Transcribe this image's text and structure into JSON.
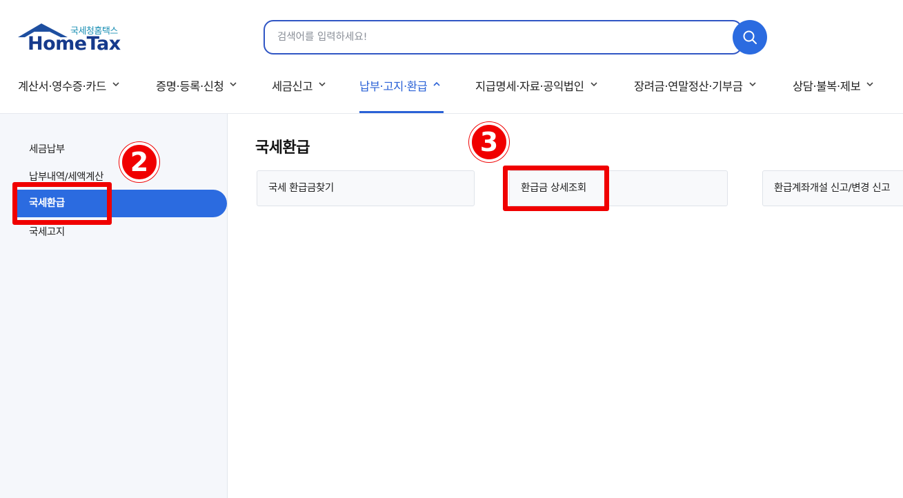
{
  "logo": {
    "sub_text": "국세청홈택스",
    "main_text": "HomeTax"
  },
  "search": {
    "placeholder": "검색어를 입력하세요!"
  },
  "nav": {
    "items": [
      {
        "label": "계산서·영수증·카드"
      },
      {
        "label": "증명·등록·신청"
      },
      {
        "label": "세금신고"
      },
      {
        "label": "납부·고지·환급"
      },
      {
        "label": "지급명세·자료·공익법인"
      },
      {
        "label": "장려금·연말정산·기부금"
      },
      {
        "label": "상담·불복·제보"
      }
    ],
    "active_index": 3
  },
  "sidebar": {
    "items": [
      {
        "label": "세금납부"
      },
      {
        "label": "납부내역/세액계산"
      },
      {
        "label": "국세환급"
      },
      {
        "label": "국세고지"
      }
    ],
    "active_index": 2
  },
  "content": {
    "title": "국세환급",
    "cards": [
      {
        "label": "국세 환급금찾기"
      },
      {
        "label": "환급금 상세조회"
      },
      {
        "label": "환급계좌개설 신고/변경 신고"
      }
    ]
  },
  "annotations": {
    "step2": "2",
    "step3": "3",
    "color": "#f00000"
  },
  "colors": {
    "accent": "#2b6be0",
    "nav_active": "#2a61d6",
    "logo_blue": "#163a8c"
  }
}
